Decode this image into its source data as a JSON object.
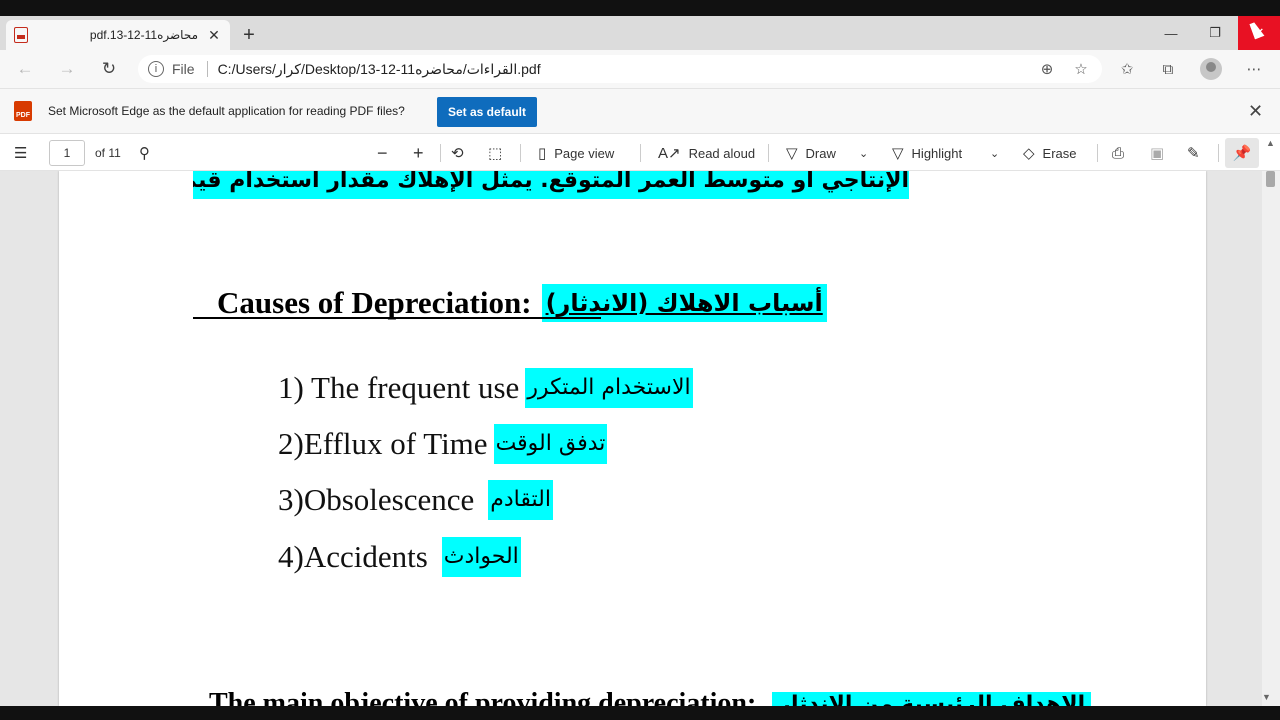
{
  "browser": {
    "tab_title": "pdf.13-12-11محاضره",
    "new_tab": "+",
    "window": {
      "minimize": "—",
      "restore": "❐",
      "close": "✕"
    }
  },
  "address_bar": {
    "file_label": "File",
    "url": "C:/Users/كرار/Desktop/13-12-11القراءات/محاضره.pdf"
  },
  "infobar": {
    "message": "Set Microsoft Edge as the default application for reading PDF files?",
    "button": "Set as default",
    "badge": "PDF"
  },
  "pdf_toolbar": {
    "page_number": "1",
    "page_total": "of 11",
    "page_view": "Page view",
    "read_aloud": "Read aloud",
    "draw": "Draw",
    "highlight": "Highlight",
    "erase": "Erase"
  },
  "document": {
    "top_arabic": "الإنتاجي أو متوسط العمر المتوقع. يمثل الإهلاك مقدار استخدام قيمة الأصل",
    "heading_en": "Causes of Depreciation:",
    "heading_ar": "أسباب الاهلاك (الاندثار)",
    "items": [
      {
        "en": "1) The frequent use",
        "ar": "الاستخدام المتكرر"
      },
      {
        "en": "2)Efflux of Time",
        "ar": "تدفق الوقت"
      },
      {
        "en": "3)Obsolescence",
        "ar": "التقادم"
      },
      {
        "en": "4)Accidents",
        "ar": "الحوادث"
      }
    ],
    "bottom_en": "The main objective of providing depreciation:",
    "bottom_ar": "الاهداف الرئيسية من الاندثار"
  },
  "colors": {
    "highlight": "#00ffff",
    "accent": "#0f6cbd",
    "close_red": "#e81123"
  }
}
